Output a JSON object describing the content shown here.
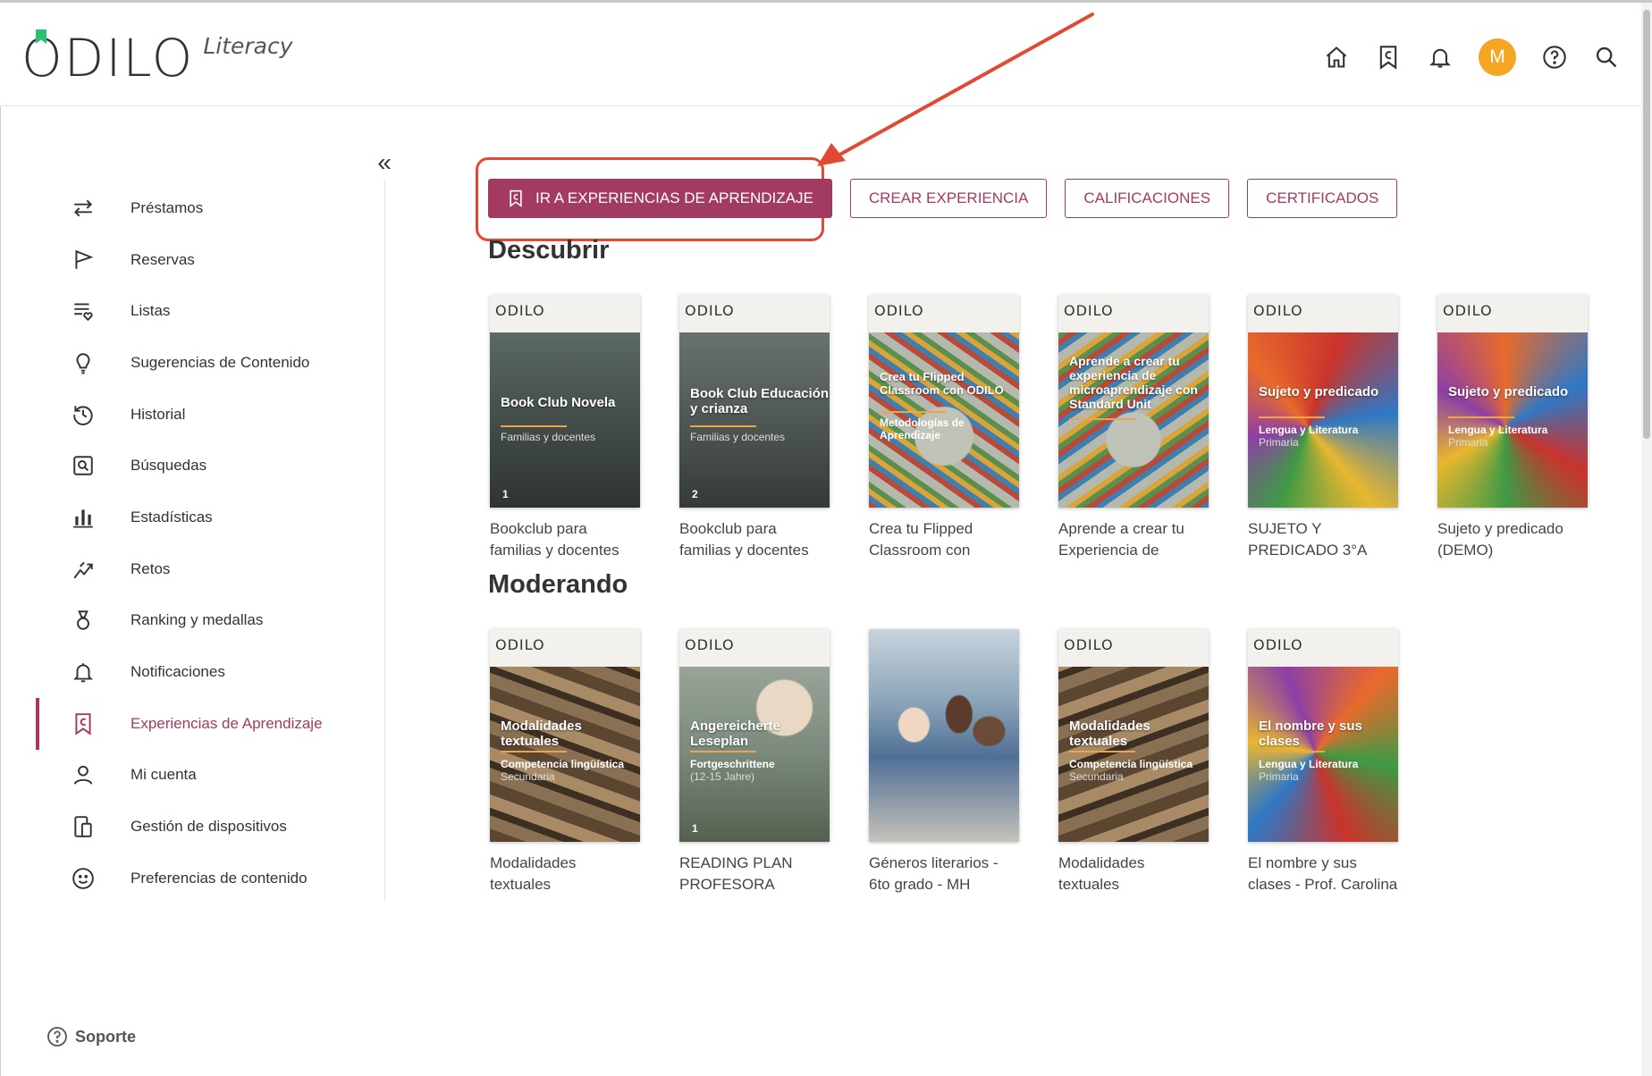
{
  "brand": {
    "name": "ODILO",
    "product": "Literacy"
  },
  "header": {
    "icons": [
      "home-icon",
      "bookmark-icon",
      "bell-icon",
      "avatar",
      "help-icon",
      "search-icon"
    ],
    "avatar_initial": "M",
    "avatar_color": "#f5a623"
  },
  "sidebar": {
    "collapse_label": "«",
    "items": [
      {
        "label": "Préstamos",
        "icon": "swap-arrows-icon"
      },
      {
        "label": "Reservas",
        "icon": "flag-icon"
      },
      {
        "label": "Listas",
        "icon": "list-heart-icon"
      },
      {
        "label": "Sugerencias de Contenido",
        "icon": "lightbulb-icon"
      },
      {
        "label": "Historial",
        "icon": "history-icon"
      },
      {
        "label": "Búsquedas",
        "icon": "search-box-icon"
      },
      {
        "label": "Estadísticas",
        "icon": "bar-chart-icon"
      },
      {
        "label": "Retos",
        "icon": "challenge-icon"
      },
      {
        "label": "Ranking y medallas",
        "icon": "medal-icon"
      },
      {
        "label": "Notificaciones",
        "icon": "bell-icon"
      },
      {
        "label": "Experiencias de Aprendizaje",
        "icon": "learning-bookmark-icon",
        "active": true
      },
      {
        "label": "Mi cuenta",
        "icon": "user-icon"
      },
      {
        "label": "Gestión de dispositivos",
        "icon": "devices-icon"
      },
      {
        "label": "Preferencias de contenido",
        "icon": "smiley-icon"
      }
    ],
    "support_label": "Soporte"
  },
  "actions": {
    "primary": "IR A EXPERIENCIAS DE APRENDIZAJE",
    "create": "CREAR EXPERIENCIA",
    "grades": "CALIFICACIONES",
    "certificates": "CERTIFICADOS"
  },
  "sections": [
    {
      "title": "Descubrir",
      "cards": [
        {
          "cover_title": "Book Club Novela",
          "cover_sub": "Familias y docentes",
          "cover_num": "1",
          "caption": "Bookclub para familias y docentes",
          "theme": "book"
        },
        {
          "cover_title": "Book Club Educación y crianza",
          "cover_sub": "Familias y docentes",
          "cover_num": "2",
          "caption": "Bookclub para familias y docentes",
          "theme": "book"
        },
        {
          "cover_title": "Crea tu Flipped Classroom con ODILO",
          "cover_sub": "Metodologías de Aprendizaje",
          "caption": "Crea tu Flipped Classroom con ODILO",
          "theme": "bulb"
        },
        {
          "cover_title": "Aprende a crear tu experiencia de microaprendizaje con Standard Unit",
          "caption": "Aprende a crear tu Experiencia de microaprendizaje",
          "theme": "bulb"
        },
        {
          "cover_title": "Sujeto y predicado",
          "cover_sub": "Lengua y Literatura",
          "cover_sub2": "Primaria",
          "caption": "SUJETO Y PREDICADO 3°A",
          "theme": "letters"
        },
        {
          "cover_title": "Sujeto y predicado",
          "cover_sub": "Lengua y Literatura",
          "cover_sub2": "Primaria",
          "caption": "Sujeto y predicado (DEMO)",
          "theme": "letters"
        }
      ]
    },
    {
      "title": "Moderando",
      "cards": [
        {
          "cover_title": "Modalidades textuales",
          "cover_sub": "Competencia lingüística",
          "cover_sub2": "Secundaria",
          "caption": "Modalidades textuales",
          "theme": "blocks"
        },
        {
          "cover_title": "Angereicherte Leseplan",
          "cover_sub": "Fortgeschrittene",
          "cover_sub2": "(12-15 Jahre)",
          "cover_num": "1",
          "caption": "READING PLAN PROFESORA CAROLINA",
          "theme": "reader"
        },
        {
          "caption": "Géneros literarios - 6to grado - MH",
          "theme": "kids"
        },
        {
          "cover_title": "Modalidades textuales",
          "cover_sub": "Competencia lingüística",
          "cover_sub2": "Secundaria",
          "caption": "Modalidades textuales",
          "theme": "blocks"
        },
        {
          "cover_title": "El nombre y sus clases",
          "cover_sub": "Lengua y Literatura",
          "cover_sub2": "Primaria",
          "caption": "El nombre y sus clases - Prof. Carolina",
          "theme": "letters"
        }
      ]
    }
  ],
  "colors": {
    "accent": "#a33a62",
    "annotation": "#e04a35"
  }
}
